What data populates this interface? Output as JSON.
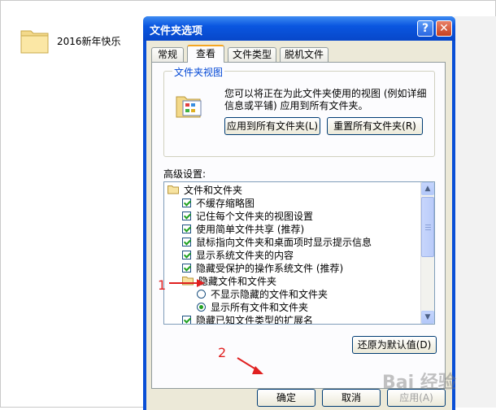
{
  "desktop": {
    "folder_label": "2016新年快乐"
  },
  "dialog": {
    "title": "文件夹选项",
    "help_button": "?",
    "close_button": "✕",
    "tabs": [
      "常规",
      "查看",
      "文件类型",
      "脱机文件"
    ],
    "active_tab": 1,
    "folder_views": {
      "title": "文件夹视图",
      "description": "您可以将正在为此文件夹使用的视图 (例如详细信息或平铺) 应用到所有文件夹。",
      "apply_button": "应用到所有文件夹(L)",
      "reset_button": "重置所有文件夹(R)"
    },
    "advanced_label": "高级设置:",
    "settings": [
      {
        "type": "folder",
        "label": "文件和文件夹",
        "indent": 0
      },
      {
        "type": "checkbox",
        "label": "不缓存缩略图",
        "checked": true,
        "indent": 1
      },
      {
        "type": "checkbox",
        "label": "记住每个文件夹的视图设置",
        "checked": true,
        "indent": 1
      },
      {
        "type": "checkbox",
        "label": "使用简单文件共享 (推荐)",
        "checked": true,
        "indent": 1
      },
      {
        "type": "checkbox",
        "label": "鼠标指向文件夹和桌面项时显示提示信息",
        "checked": true,
        "indent": 1
      },
      {
        "type": "checkbox",
        "label": "显示系统文件夹的内容",
        "checked": true,
        "indent": 1
      },
      {
        "type": "checkbox",
        "label": "隐藏受保护的操作系统文件 (推荐)",
        "checked": true,
        "indent": 1
      },
      {
        "type": "folder",
        "label": "隐藏文件和文件夹",
        "indent": 1
      },
      {
        "type": "radio",
        "label": "不显示隐藏的文件和文件夹",
        "selected": false,
        "indent": 2
      },
      {
        "type": "radio",
        "label": "显示所有文件和文件夹",
        "selected": true,
        "indent": 2
      },
      {
        "type": "checkbox",
        "label": "隐藏已知文件类型的扩展名",
        "checked": true,
        "indent": 1
      }
    ],
    "restore_defaults_button": "还原为默认值(D)",
    "ok_button": "确定",
    "cancel_button": "取消",
    "apply_button": "应用(A)"
  },
  "annotations": {
    "marker_1": "1",
    "marker_2": "2"
  },
  "watermark": "Bai 经验"
}
